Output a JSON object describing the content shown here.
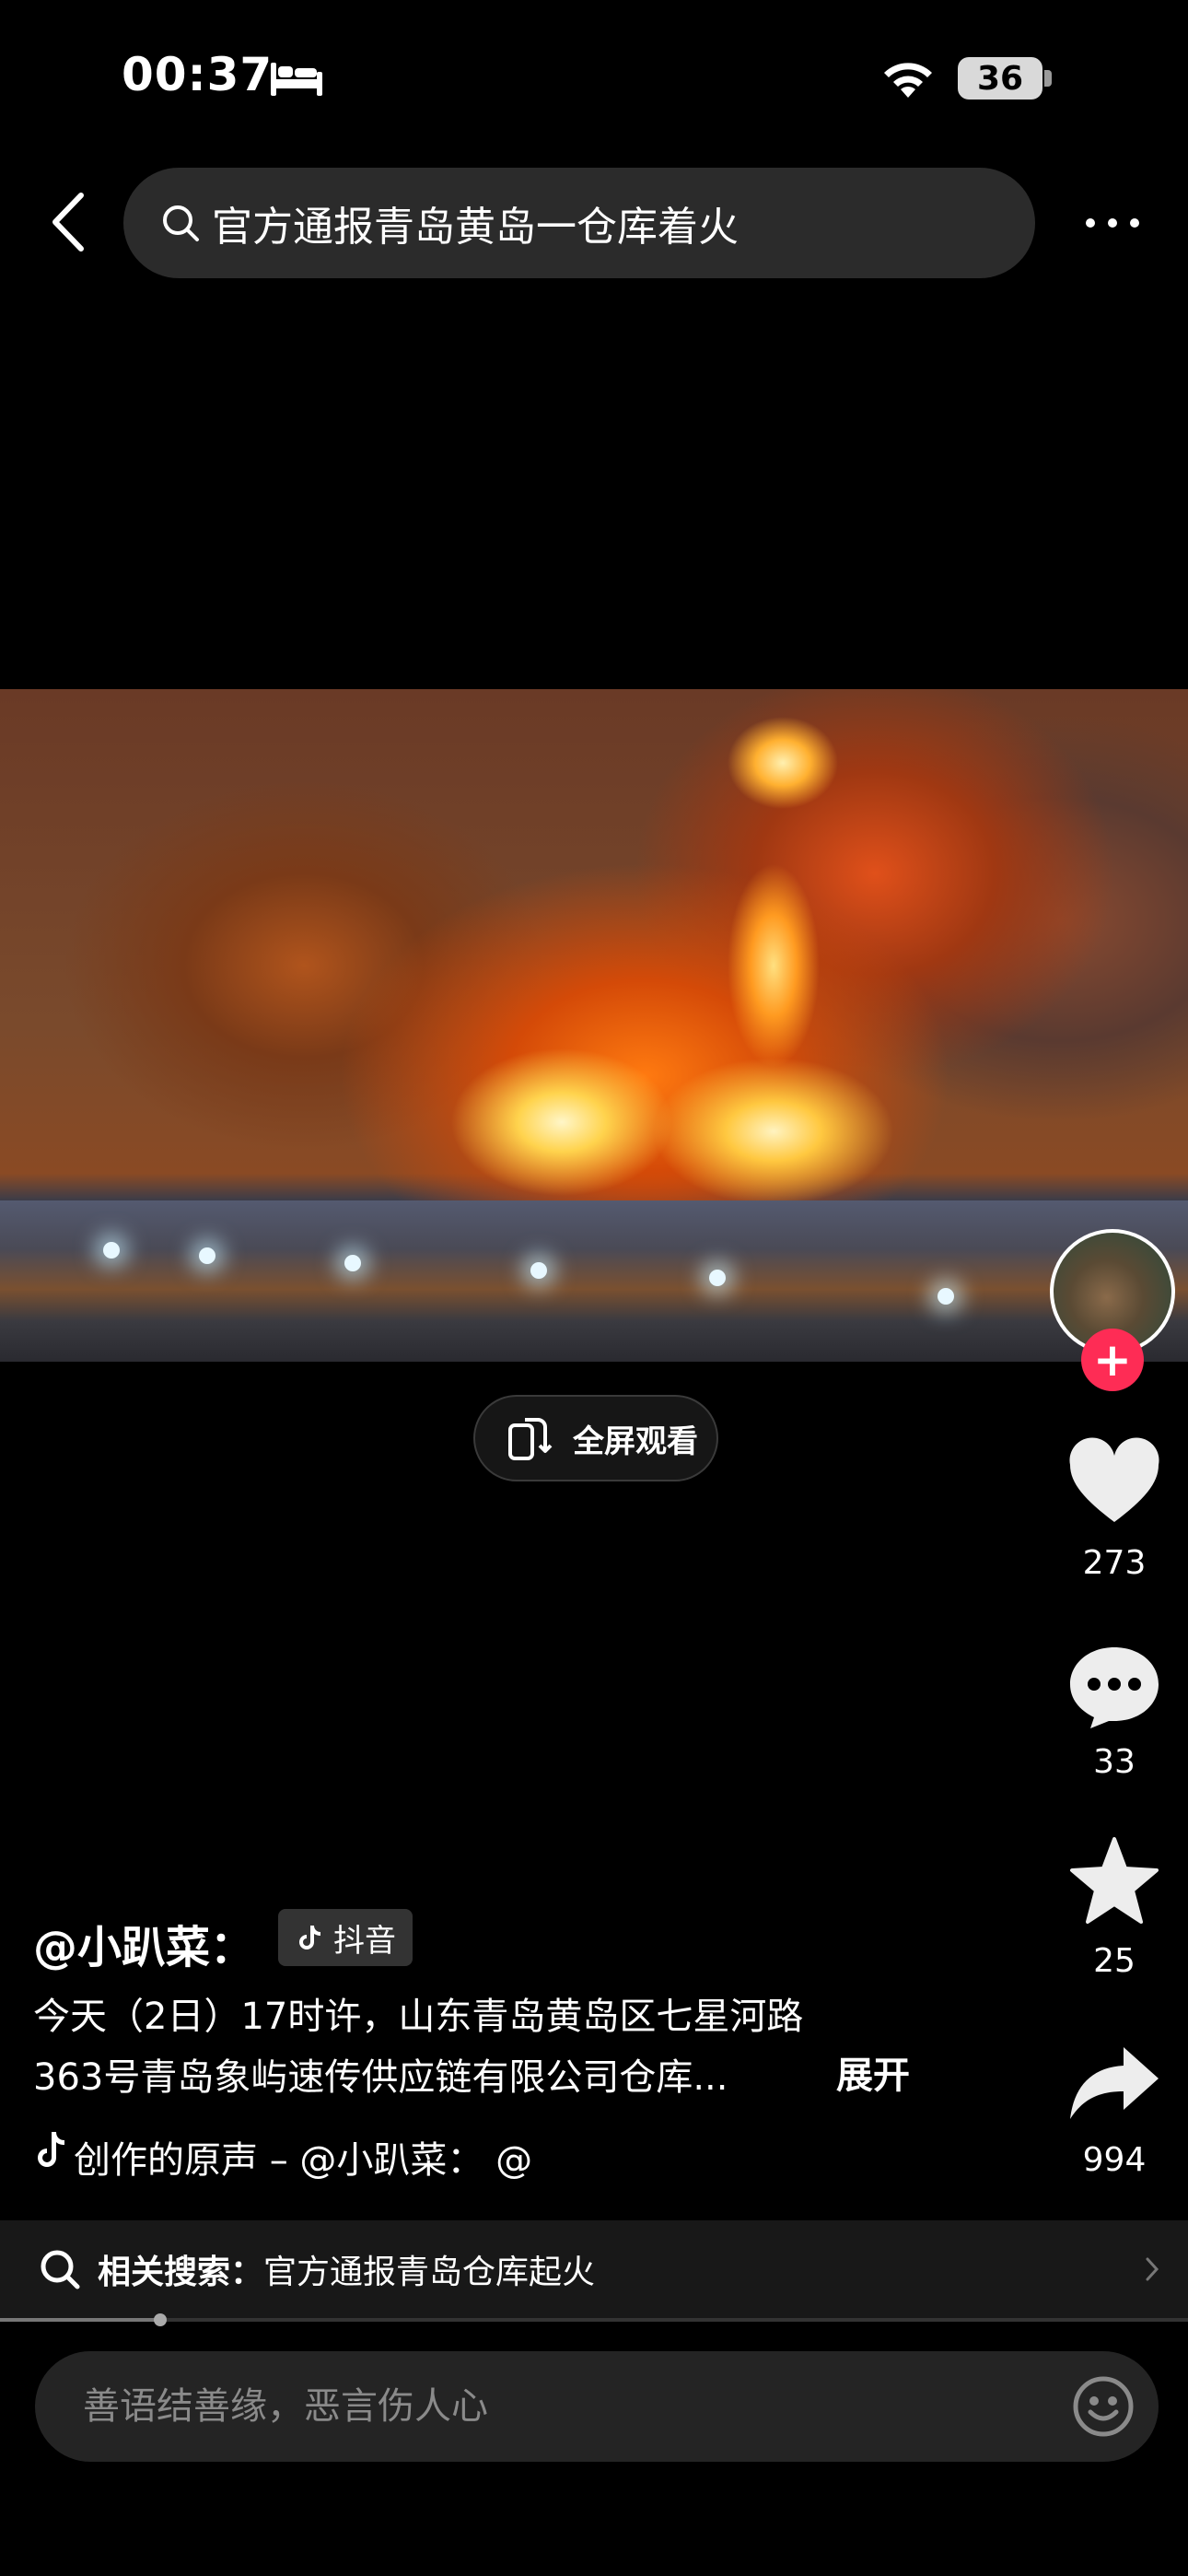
{
  "status_bar": {
    "time": "00:37",
    "battery": "36"
  },
  "top_bar": {
    "search_text": "官方通报青岛黄岛一仓库着火"
  },
  "video": {
    "fullscreen_label": "全屏观看"
  },
  "rail": {
    "likes": "273",
    "comments": "33",
    "favorites": "25",
    "shares": "994"
  },
  "caption": {
    "author": "@小趴菜：",
    "badge": "抖音",
    "line1": "今天（2日）17时许，山东青岛黄岛区七星河路",
    "line2": "363号青岛象屿速传供应链有限公司仓库...",
    "expand": "展开",
    "music": "创作的原声 – @小趴菜：     @"
  },
  "related": {
    "label": "相关搜索：",
    "query": "官方通报青岛仓库起火"
  },
  "progress": 0.135,
  "comment": {
    "placeholder": "善语结善缘，恶言伤人心"
  },
  "colors": {
    "accent": "#fe2c55",
    "background": "#000000"
  }
}
